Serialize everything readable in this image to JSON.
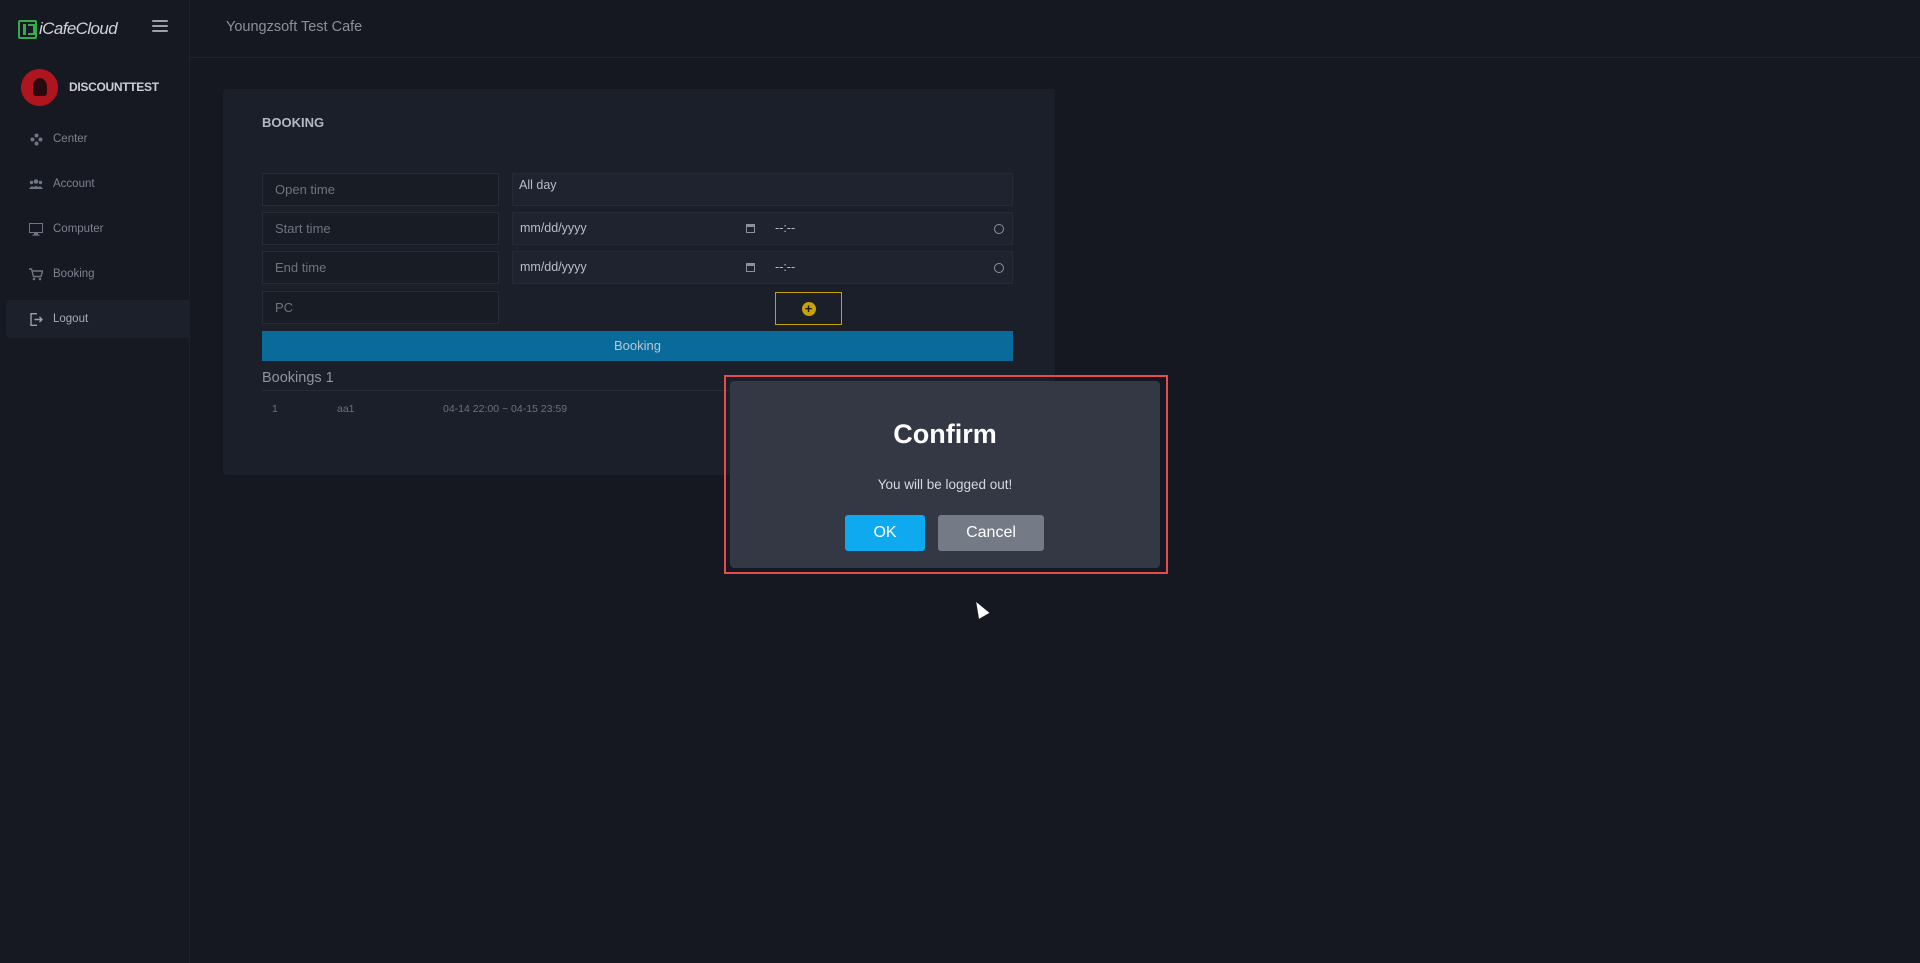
{
  "app": {
    "logo_text": "iCafeCloud",
    "cafe_name": "Youngzsoft Test Cafe"
  },
  "user": {
    "name": "DISCOUNTTEST"
  },
  "sidebar": {
    "items": [
      {
        "label": "Center",
        "icon": "gamepad-icon"
      },
      {
        "label": "Account",
        "icon": "users-icon"
      },
      {
        "label": "Computer",
        "icon": "monitor-icon"
      },
      {
        "label": "Booking",
        "icon": "cart-icon"
      },
      {
        "label": "Logout",
        "icon": "logout-icon"
      }
    ]
  },
  "booking": {
    "title": "BOOKING",
    "open_time_label": "Open time",
    "open_time_value": "All day",
    "start_time_label": "Start time",
    "start_date_placeholder": "mm/dd/yyyy",
    "start_time_placeholder": "--:--",
    "end_time_label": "End time",
    "end_date_placeholder": "mm/dd/yyyy",
    "end_time_placeholder": "--:--",
    "pc_label": "PC",
    "add_symbol": "+",
    "submit_label": "Booking",
    "list_title": "Bookings 1",
    "rows": [
      {
        "index": "1",
        "pc": "aa1",
        "range": "04-14 22:00 ~ 04-15 23:59"
      }
    ]
  },
  "modal": {
    "title": "Confirm",
    "message": "You will be logged out!",
    "ok_label": "OK",
    "cancel_label": "Cancel"
  },
  "colors": {
    "accent": "#0fa9f0",
    "booking_button": "#0a6a9a",
    "add_button": "#c9a106",
    "highlight_outline": "#e74c4c"
  }
}
